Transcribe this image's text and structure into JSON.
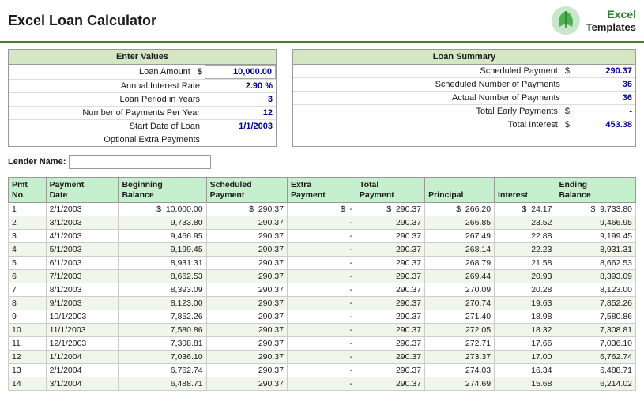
{
  "header": {
    "title": "Excel Loan Calculator",
    "logo": {
      "excel": "Excel",
      "templates": "Templates"
    }
  },
  "enter_values": {
    "header": "Enter Values",
    "fields": [
      {
        "label": "Loan Amount",
        "dollar": "$",
        "value": "10,000.00"
      },
      {
        "label": "Annual Interest Rate",
        "value": "2.90 %"
      },
      {
        "label": "Loan Period in Years",
        "value": "3"
      },
      {
        "label": "Number of Payments Per Year",
        "value": "12"
      },
      {
        "label": "Start Date of Loan",
        "value": "1/1/2003"
      },
      {
        "label": "Optional Extra Payments",
        "value": ""
      }
    ]
  },
  "loan_summary": {
    "header": "Loan Summary",
    "rows": [
      {
        "label": "Scheduled Payment",
        "dollar": "$",
        "value": "290.37"
      },
      {
        "label": "Scheduled Number of Payments",
        "dollar": "",
        "value": "36"
      },
      {
        "label": "Actual Number of Payments",
        "dollar": "",
        "value": "36"
      },
      {
        "label": "Total Early Payments",
        "dollar": "$",
        "value": "-"
      },
      {
        "label": "Total Interest",
        "dollar": "$",
        "value": "453.38"
      }
    ]
  },
  "lender": {
    "label": "Lender Name:",
    "value": ""
  },
  "table": {
    "headers": [
      {
        "id": "pmt-no",
        "lines": [
          "Pmt",
          "No."
        ]
      },
      {
        "id": "payment-date",
        "lines": [
          "Payment",
          "Date"
        ]
      },
      {
        "id": "beginning-balance",
        "lines": [
          "Beginning",
          "Balance"
        ]
      },
      {
        "id": "scheduled-payment",
        "lines": [
          "Scheduled",
          "Payment"
        ]
      },
      {
        "id": "extra-payment",
        "lines": [
          "Extra",
          "Payment"
        ]
      },
      {
        "id": "total-payment",
        "lines": [
          "Total",
          "Payment"
        ]
      },
      {
        "id": "principal",
        "lines": [
          "Principal"
        ]
      },
      {
        "id": "interest",
        "lines": [
          "Interest"
        ]
      },
      {
        "id": "ending-balance",
        "lines": [
          "Ending",
          "Balance"
        ]
      }
    ],
    "rows": [
      {
        "pmt": "1",
        "date": "2/1/2003",
        "beg_bal_d": "$",
        "beg_bal": "10,000.00",
        "sched_d": "$",
        "sched": "290.37",
        "extra_d": "$",
        "extra": "-",
        "total_d": "$",
        "total": "290.37",
        "prin_d": "$",
        "prin": "266.20",
        "int_d": "$",
        "int": "24.17",
        "end_d": "$",
        "end_bal": "9,733.80"
      },
      {
        "pmt": "2",
        "date": "3/1/2003",
        "beg_bal": "9,733.80",
        "sched": "290.37",
        "extra": "-",
        "total": "290.37",
        "prin": "266.85",
        "int": "23.52",
        "end_bal": "9,466.95"
      },
      {
        "pmt": "3",
        "date": "4/1/2003",
        "beg_bal": "9,466.95",
        "sched": "290.37",
        "extra": "-",
        "total": "290.37",
        "prin": "267.49",
        "int": "22.88",
        "end_bal": "9,199.45"
      },
      {
        "pmt": "4",
        "date": "5/1/2003",
        "beg_bal": "9,199.45",
        "sched": "290.37",
        "extra": "-",
        "total": "290.37",
        "prin": "268.14",
        "int": "22.23",
        "end_bal": "8,931.31"
      },
      {
        "pmt": "5",
        "date": "6/1/2003",
        "beg_bal": "8,931.31",
        "sched": "290.37",
        "extra": "-",
        "total": "290.37",
        "prin": "268.79",
        "int": "21.58",
        "end_bal": "8,662.53"
      },
      {
        "pmt": "6",
        "date": "7/1/2003",
        "beg_bal": "8,662.53",
        "sched": "290.37",
        "extra": "-",
        "total": "290.37",
        "prin": "269.44",
        "int": "20.93",
        "end_bal": "8,393.09"
      },
      {
        "pmt": "7",
        "date": "8/1/2003",
        "beg_bal": "8,393.09",
        "sched": "290.37",
        "extra": "-",
        "total": "290.37",
        "prin": "270.09",
        "int": "20.28",
        "end_bal": "8,123.00"
      },
      {
        "pmt": "8",
        "date": "9/1/2003",
        "beg_bal": "8,123.00",
        "sched": "290.37",
        "extra": "-",
        "total": "290.37",
        "prin": "270.74",
        "int": "19.63",
        "end_bal": "7,852.26"
      },
      {
        "pmt": "9",
        "date": "10/1/2003",
        "beg_bal": "7,852.26",
        "sched": "290.37",
        "extra": "-",
        "total": "290.37",
        "prin": "271.40",
        "int": "18.98",
        "end_bal": "7,580.86"
      },
      {
        "pmt": "10",
        "date": "11/1/2003",
        "beg_bal": "7,580.86",
        "sched": "290.37",
        "extra": "-",
        "total": "290.37",
        "prin": "272.05",
        "int": "18.32",
        "end_bal": "7,308.81"
      },
      {
        "pmt": "11",
        "date": "12/1/2003",
        "beg_bal": "7,308.81",
        "sched": "290.37",
        "extra": "-",
        "total": "290.37",
        "prin": "272.71",
        "int": "17.66",
        "end_bal": "7,036.10"
      },
      {
        "pmt": "12",
        "date": "1/1/2004",
        "beg_bal": "7,036.10",
        "sched": "290.37",
        "extra": "-",
        "total": "290.37",
        "prin": "273.37",
        "int": "17.00",
        "end_bal": "6,762.74"
      },
      {
        "pmt": "13",
        "date": "2/1/2004",
        "beg_bal": "6,762.74",
        "sched": "290.37",
        "extra": "-",
        "total": "290.37",
        "prin": "274.03",
        "int": "16.34",
        "end_bal": "6,488.71"
      },
      {
        "pmt": "14",
        "date": "3/1/2004",
        "beg_bal": "6,488.71",
        "sched": "290.37",
        "extra": "-",
        "total": "290.37",
        "prin": "274.69",
        "int": "15.68",
        "end_bal": "6,214.02"
      }
    ]
  }
}
